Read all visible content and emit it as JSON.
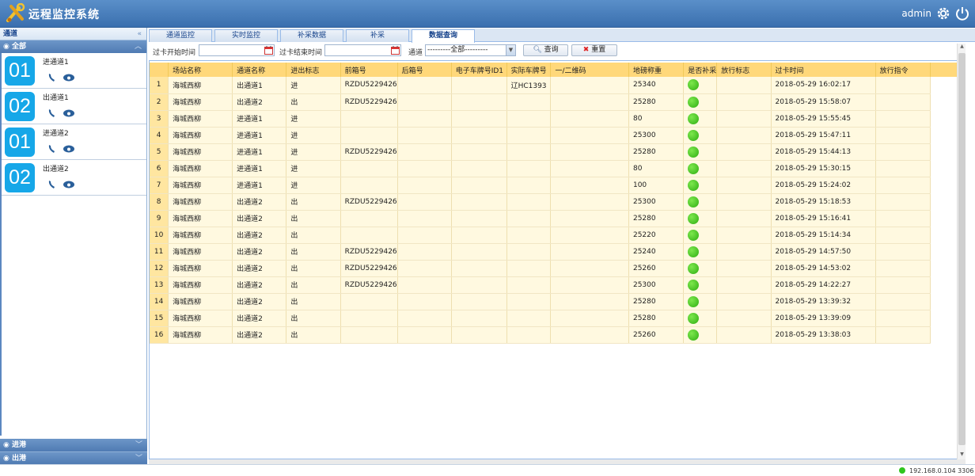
{
  "app": {
    "title": "远程监控系统",
    "user": "admin"
  },
  "sidebar": {
    "header": "通道",
    "collapse": "«",
    "all_group": "全部",
    "lanes": [
      {
        "number": "01",
        "name": "进通道1"
      },
      {
        "number": "02",
        "name": "出通道1"
      },
      {
        "number": "01",
        "name": "进通道2"
      },
      {
        "number": "02",
        "name": "出通道2"
      }
    ],
    "bottom_groups": [
      "进港",
      "出港"
    ]
  },
  "tabs": [
    {
      "label": "通道监控"
    },
    {
      "label": "实时监控"
    },
    {
      "label": "补采数据"
    },
    {
      "label": "补采"
    },
    {
      "label": "数据查询"
    }
  ],
  "toolbar": {
    "start_label": "过卡开始时间",
    "end_label": "过卡结束时间",
    "channel_label": "通道",
    "channel_value": "---------全部---------",
    "query_button": "查询",
    "reset_button": "重置"
  },
  "table": {
    "columns": [
      "场站名称",
      "通道名称",
      "进出标志",
      "前箱号",
      "后箱号",
      "电子车牌号ID1",
      "实际车牌号",
      "一/二维码",
      "地磅称重",
      "是否补采",
      "放行标志",
      "过卡时间",
      "放行指令"
    ],
    "rows": [
      {
        "n": "1",
        "station": "海城西柳",
        "lane": "出通道1",
        "dir": "进",
        "front": "RZDU5229426",
        "rear": "",
        "eplate": "",
        "plate": "辽HC1393",
        "code": "",
        "weight": "25340",
        "flag": "",
        "time": "2018-05-29 16:02:17",
        "cmd": ""
      },
      {
        "n": "2",
        "station": "海城西柳",
        "lane": "出通道2",
        "dir": "出",
        "front": "RZDU5229426",
        "rear": "",
        "eplate": "",
        "plate": "",
        "code": "",
        "weight": "25280",
        "flag": "",
        "time": "2018-05-29 15:58:07",
        "cmd": ""
      },
      {
        "n": "3",
        "station": "海城西柳",
        "lane": "进通道1",
        "dir": "进",
        "front": "",
        "rear": "",
        "eplate": "",
        "plate": "",
        "code": "",
        "weight": "80",
        "flag": "",
        "time": "2018-05-29 15:55:45",
        "cmd": ""
      },
      {
        "n": "4",
        "station": "海城西柳",
        "lane": "进通道1",
        "dir": "进",
        "front": "",
        "rear": "",
        "eplate": "",
        "plate": "",
        "code": "",
        "weight": "25300",
        "flag": "",
        "time": "2018-05-29 15:47:11",
        "cmd": ""
      },
      {
        "n": "5",
        "station": "海城西柳",
        "lane": "进通道1",
        "dir": "进",
        "front": "RZDU5229426",
        "rear": "",
        "eplate": "",
        "plate": "",
        "code": "",
        "weight": "25280",
        "flag": "",
        "time": "2018-05-29 15:44:13",
        "cmd": ""
      },
      {
        "n": "6",
        "station": "海城西柳",
        "lane": "进通道1",
        "dir": "进",
        "front": "",
        "rear": "",
        "eplate": "",
        "plate": "",
        "code": "",
        "weight": "80",
        "flag": "",
        "time": "2018-05-29 15:30:15",
        "cmd": ""
      },
      {
        "n": "7",
        "station": "海城西柳",
        "lane": "进通道1",
        "dir": "进",
        "front": "",
        "rear": "",
        "eplate": "",
        "plate": "",
        "code": "",
        "weight": "100",
        "flag": "",
        "time": "2018-05-29 15:24:02",
        "cmd": ""
      },
      {
        "n": "8",
        "station": "海城西柳",
        "lane": "出通道2",
        "dir": "出",
        "front": "RZDU5229426",
        "rear": "",
        "eplate": "",
        "plate": "",
        "code": "",
        "weight": "25300",
        "flag": "",
        "time": "2018-05-29 15:18:53",
        "cmd": ""
      },
      {
        "n": "9",
        "station": "海城西柳",
        "lane": "出通道2",
        "dir": "出",
        "front": "",
        "rear": "",
        "eplate": "",
        "plate": "",
        "code": "",
        "weight": "25280",
        "flag": "",
        "time": "2018-05-29 15:16:41",
        "cmd": ""
      },
      {
        "n": "10",
        "station": "海城西柳",
        "lane": "出通道2",
        "dir": "出",
        "front": "",
        "rear": "",
        "eplate": "",
        "plate": "",
        "code": "",
        "weight": "25220",
        "flag": "",
        "time": "2018-05-29 15:14:34",
        "cmd": ""
      },
      {
        "n": "11",
        "station": "海城西柳",
        "lane": "出通道2",
        "dir": "出",
        "front": "RZDU5229426",
        "rear": "",
        "eplate": "",
        "plate": "",
        "code": "",
        "weight": "25240",
        "flag": "",
        "time": "2018-05-29 14:57:50",
        "cmd": ""
      },
      {
        "n": "12",
        "station": "海城西柳",
        "lane": "出通道2",
        "dir": "出",
        "front": "RZDU5229426",
        "rear": "",
        "eplate": "",
        "plate": "",
        "code": "",
        "weight": "25260",
        "flag": "",
        "time": "2018-05-29 14:53:02",
        "cmd": ""
      },
      {
        "n": "13",
        "station": "海城西柳",
        "lane": "出通道2",
        "dir": "出",
        "front": "RZDU5229426",
        "rear": "",
        "eplate": "",
        "plate": "",
        "code": "",
        "weight": "25300",
        "flag": "",
        "time": "2018-05-29 14:22:27",
        "cmd": ""
      },
      {
        "n": "14",
        "station": "海城西柳",
        "lane": "出通道2",
        "dir": "出",
        "front": "",
        "rear": "",
        "eplate": "",
        "plate": "",
        "code": "",
        "weight": "25280",
        "flag": "",
        "time": "2018-05-29 13:39:32",
        "cmd": ""
      },
      {
        "n": "15",
        "station": "海城西柳",
        "lane": "出通道2",
        "dir": "出",
        "front": "",
        "rear": "",
        "eplate": "",
        "plate": "",
        "code": "",
        "weight": "25280",
        "flag": "",
        "time": "2018-05-29 13:39:09",
        "cmd": ""
      },
      {
        "n": "16",
        "station": "海城西柳",
        "lane": "出通道2",
        "dir": "出",
        "front": "",
        "rear": "",
        "eplate": "",
        "plate": "",
        "code": "",
        "weight": "25260",
        "flag": "",
        "time": "2018-05-29 13:38:03",
        "cmd": ""
      }
    ]
  },
  "status": {
    "connection": "192.168.0.104 3306",
    "connected_color": "#2fc51d"
  },
  "colors": {
    "header": "#3a6fae",
    "badge": "#16a7e8",
    "table_header": "#ffd87a",
    "row": "#fff9e0",
    "supplement_dot": "#2fae13"
  },
  "icons": {
    "logo": "tools-logo-icon",
    "settings": "gear-icon",
    "power": "power-icon",
    "phone": "phone-icon",
    "camera": "camera-icon",
    "calendar": "calendar-icon",
    "search": "search-icon",
    "reset": "x-icon"
  }
}
